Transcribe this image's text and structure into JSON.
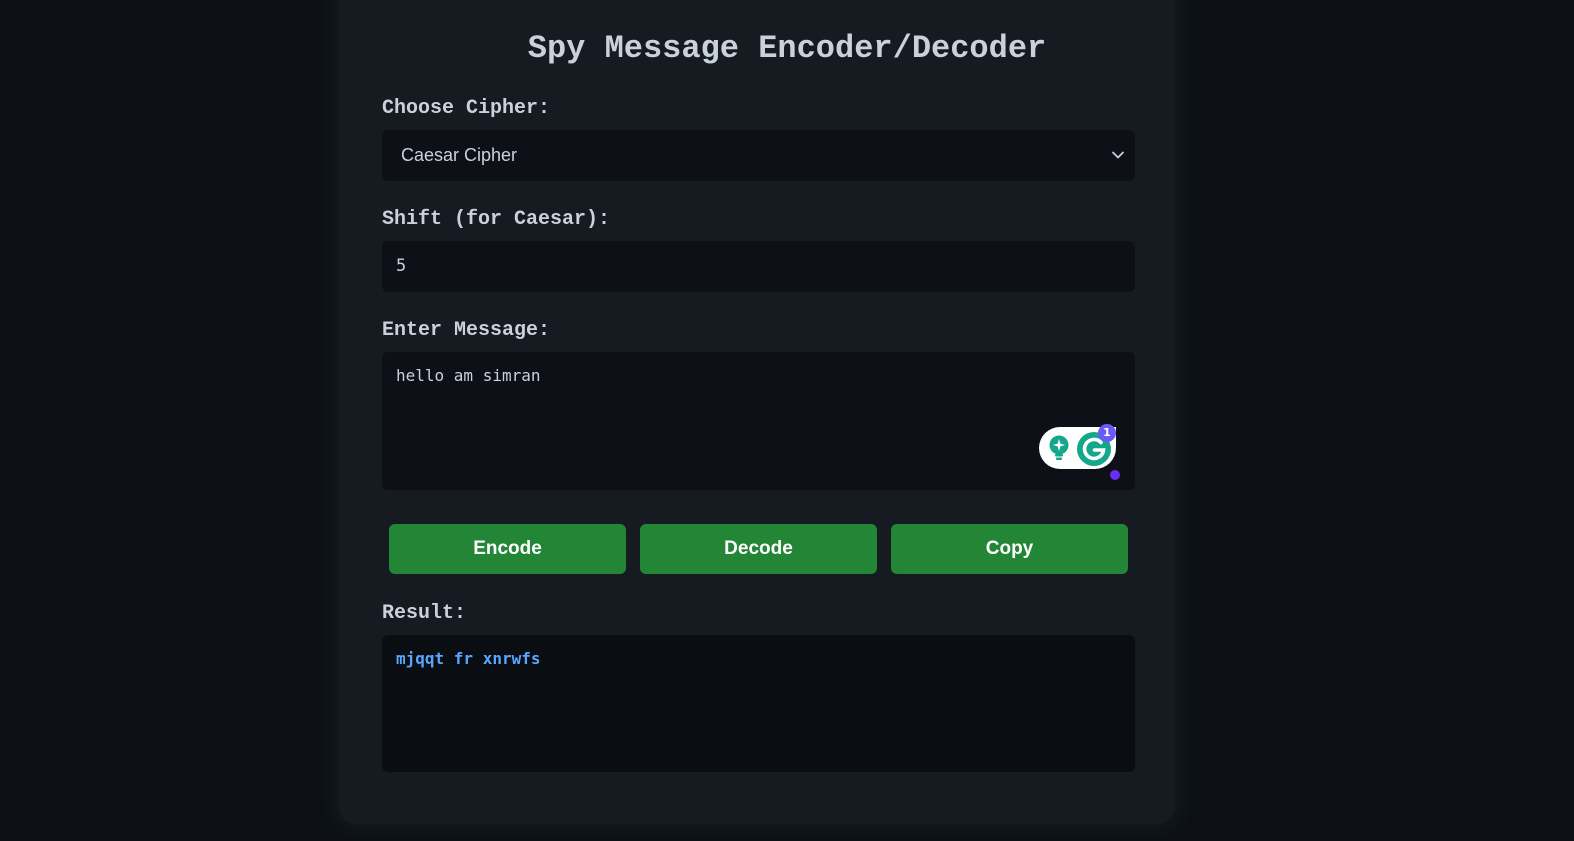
{
  "app": {
    "title": "Spy Message Encoder/Decoder"
  },
  "cipher": {
    "label": "Choose Cipher:",
    "selected": "Caesar Cipher"
  },
  "shift": {
    "label": "Shift (for Caesar):",
    "value": "5"
  },
  "message": {
    "label": "Enter Message:",
    "value": "hello am simran"
  },
  "grammarly": {
    "badge_count": "1"
  },
  "buttons": {
    "encode": "Encode",
    "decode": "Decode",
    "copy": "Copy"
  },
  "result": {
    "label": "Result:",
    "value": "mjqqt fr xnrwfs"
  },
  "colors": {
    "page_background": "#0d1117",
    "card_background": "#161b22",
    "field_background": "#0d1117",
    "button_green": "#238636",
    "result_text": "#58a6ff",
    "grammarly_green": "#15a78a",
    "grammarly_badge": "#6a5af9"
  },
  "icons": {
    "select_arrow": "chevron-down-icon",
    "grammarly": "grammarly-icon",
    "grammarly_suggestion": "lightbulb-icon"
  }
}
